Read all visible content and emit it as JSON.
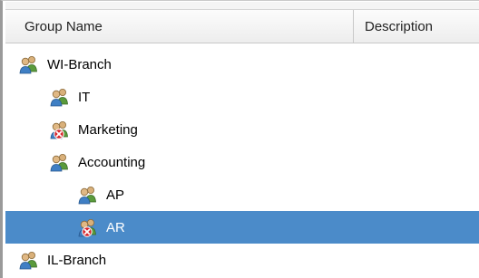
{
  "columns": {
    "group_name": "Group Name",
    "description": "Description"
  },
  "tree": [
    {
      "label": "WI-Branch",
      "level": 0,
      "icon": "group-icon",
      "selected": false
    },
    {
      "label": "IT",
      "level": 1,
      "icon": "group-icon",
      "selected": false
    },
    {
      "label": "Marketing",
      "level": 1,
      "icon": "group-disabled-icon",
      "selected": false
    },
    {
      "label": "Accounting",
      "level": 1,
      "icon": "group-icon",
      "selected": false
    },
    {
      "label": "AP",
      "level": 2,
      "icon": "group-icon",
      "selected": false
    },
    {
      "label": "AR",
      "level": 2,
      "icon": "group-disabled-icon",
      "selected": true
    },
    {
      "label": "IL-Branch",
      "level": 0,
      "icon": "group-icon",
      "selected": false
    }
  ],
  "colors": {
    "selection": "#4b8bc9",
    "disabled_badge": "#d8262b"
  }
}
